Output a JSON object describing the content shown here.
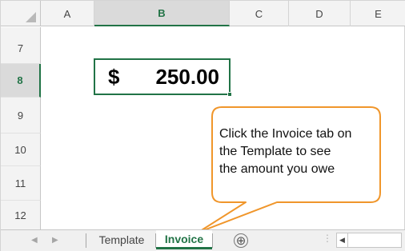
{
  "columns": [
    "A",
    "B",
    "C",
    "D",
    "E"
  ],
  "selected_column": "B",
  "rows": [
    "7",
    "8",
    "9",
    "10",
    "11",
    "12"
  ],
  "selected_row": "8",
  "active_cell": {
    "currency_symbol": "$",
    "amount": "250.00"
  },
  "callout": {
    "line1": "Click the Invoice tab on",
    "line2": "the Template to see",
    "line3": "the amount you owe"
  },
  "tabs": {
    "nav_prev": "◀",
    "nav_next": "▶",
    "sheet1": "Template",
    "sheet2": "Invoice",
    "active": "Invoice",
    "add_sheet_icon": "⊕"
  },
  "colors": {
    "accent": "#217346",
    "callout_border": "#f0962b"
  }
}
